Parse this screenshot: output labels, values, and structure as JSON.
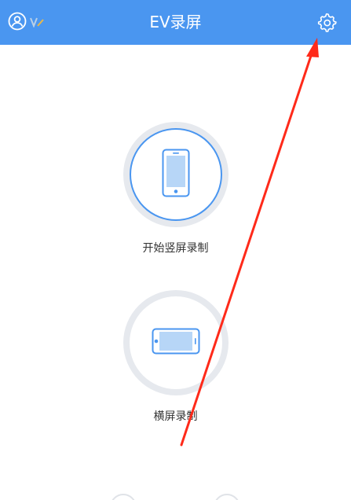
{
  "header": {
    "title": "EV录屏",
    "background_color": "#4a96f0",
    "left_icons": [
      "user-icon",
      "vip-icon"
    ],
    "right_icon": "gear-icon"
  },
  "options": [
    {
      "label": "开始竖屏录制",
      "icon": "portrait-phone-icon",
      "selected": true
    },
    {
      "label": "横屏录制",
      "icon": "landscape-phone-icon",
      "selected": false
    }
  ],
  "annotation": {
    "type": "red-arrow",
    "color": "#ff2a1a",
    "points_to": "settings-button"
  }
}
